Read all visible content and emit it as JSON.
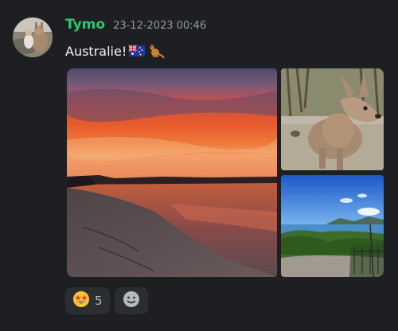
{
  "message": {
    "username": "Tymo",
    "timestamp": "23-12-2023 00:46",
    "text": "Australie!",
    "emojis": [
      "australia-flag",
      "kangaroo"
    ]
  },
  "attachments": [
    {
      "name": "sunset-beach-photo"
    },
    {
      "name": "kangaroo-photo"
    },
    {
      "name": "coastal-view-photo"
    }
  ],
  "reactions": [
    {
      "emoji": "star-struck",
      "count": "5"
    }
  ],
  "add_reaction": {
    "icon": "smiley-add-reaction-icon"
  },
  "colors": {
    "background": "#1e1f22",
    "username": "#2dc770",
    "timestamp": "#949ba4",
    "reaction_bg": "#2b2d31"
  }
}
